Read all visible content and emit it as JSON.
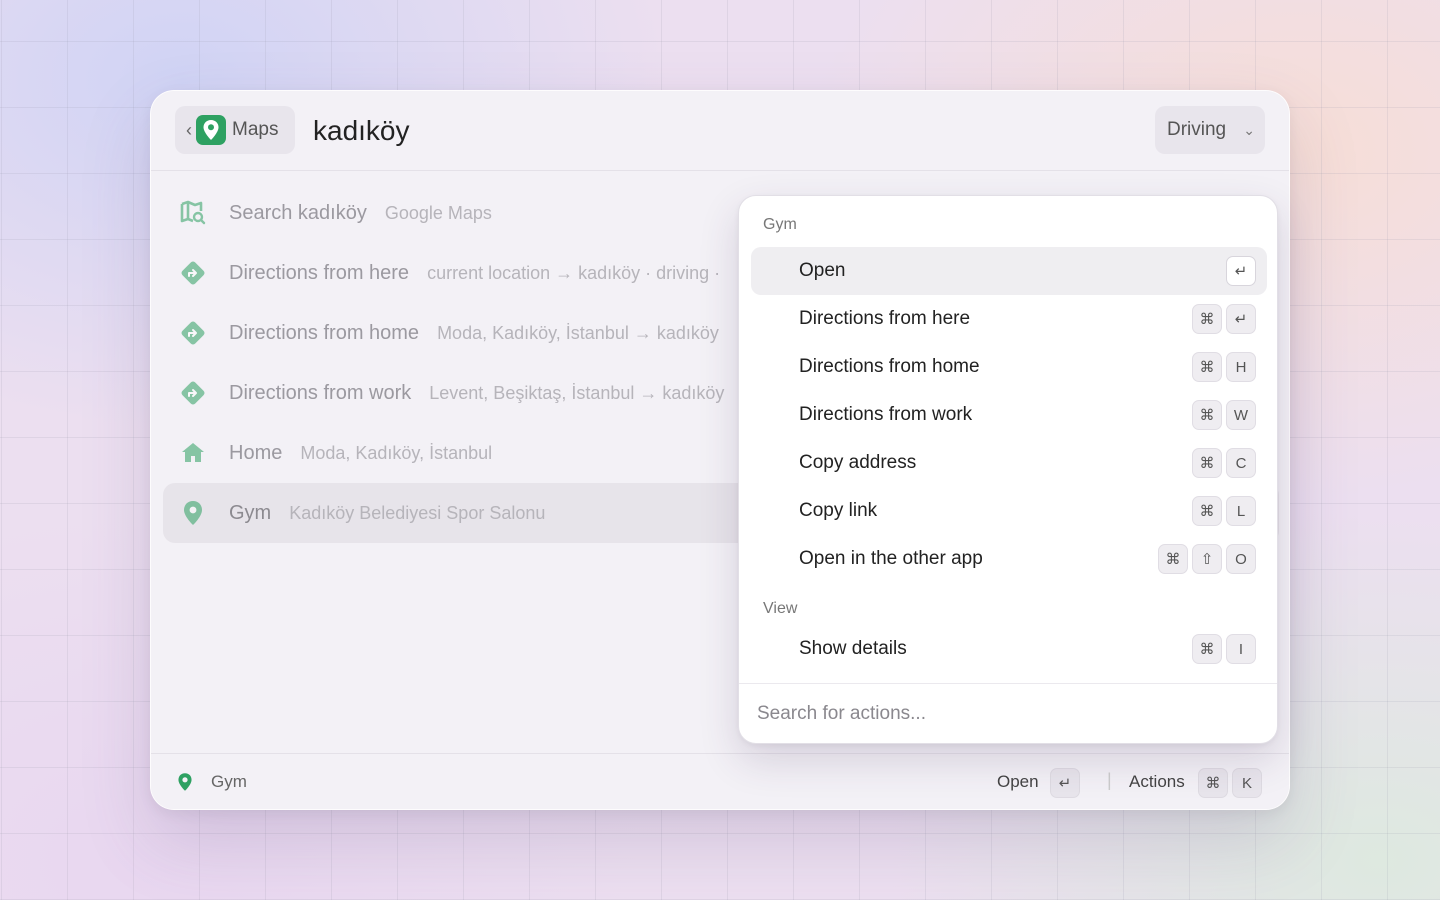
{
  "header": {
    "back_icon": "chevron-left-icon",
    "app_name": "Maps",
    "query": "kadıköy",
    "mode": "Driving"
  },
  "results": [
    {
      "icon": "map-search-icon",
      "title": "Search kadıköy",
      "subtitle": "Google Maps"
    },
    {
      "icon": "directions-icon",
      "title": "Directions from here",
      "subtitle": "current location → kadıköy · driving ·"
    },
    {
      "icon": "directions-icon",
      "title": "Directions from home",
      "subtitle": "Moda, Kadıköy, İstanbul → kadıköy"
    },
    {
      "icon": "directions-icon",
      "title": "Directions from work",
      "subtitle": "Levent, Beşiktaş, İstanbul → kadıköy"
    },
    {
      "icon": "home-icon",
      "title": "Home",
      "subtitle": "Moda, Kadıköy, İstanbul"
    },
    {
      "icon": "pin-icon",
      "title": "Gym",
      "subtitle": "Kadıköy Belediyesi Spor Salonu",
      "selected": true
    }
  ],
  "footer": {
    "title": "Gym",
    "open_label": "Open",
    "open_key": "↵",
    "separator": "|",
    "actions_label": "Actions",
    "actions_keys": [
      "⌘",
      "K"
    ]
  },
  "actions_menu": {
    "section1": "Gym",
    "items": [
      {
        "label": "Open",
        "keys": [
          "↵"
        ],
        "active": true
      },
      {
        "label": "Directions from here",
        "keys": [
          "⌘",
          "↵"
        ]
      },
      {
        "label": "Directions from home",
        "keys": [
          "⌘",
          "H"
        ]
      },
      {
        "label": "Directions from work",
        "keys": [
          "⌘",
          "W"
        ]
      },
      {
        "label": "Copy address",
        "keys": [
          "⌘",
          "C"
        ]
      },
      {
        "label": "Copy link",
        "keys": [
          "⌘",
          "L"
        ]
      },
      {
        "label": "Open in the other app",
        "keys": [
          "⌘",
          "⇧",
          "O"
        ]
      }
    ],
    "section2": "View",
    "view_items": [
      {
        "label": "Show details",
        "keys": [
          "⌘",
          "I"
        ]
      }
    ],
    "search_placeholder": "Search for actions..."
  },
  "colors": {
    "accent": "#2ea162",
    "result_icon": "#5cc08a"
  }
}
